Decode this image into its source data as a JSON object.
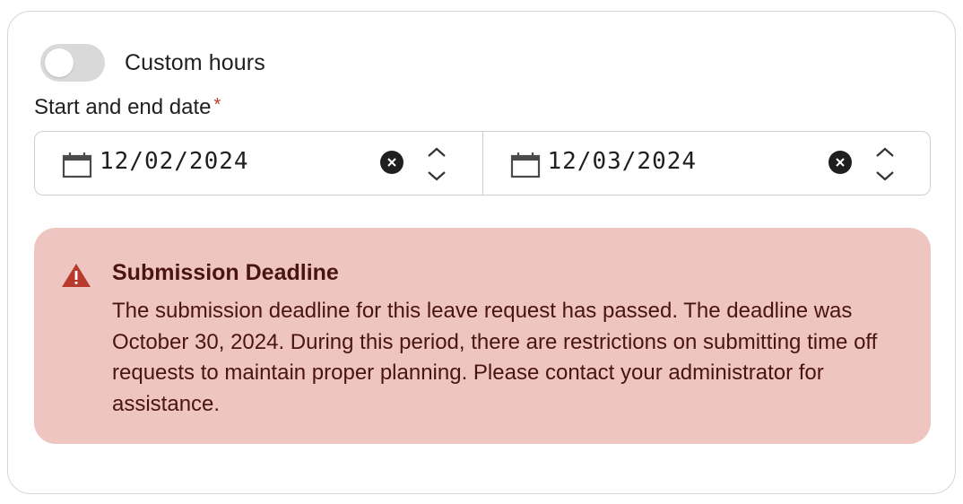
{
  "toggle": {
    "label": "Custom hours",
    "on": false
  },
  "date_field": {
    "label": "Start and end date",
    "required_mark": "*",
    "start": "12/02/2024",
    "end": "12/03/2024"
  },
  "alert": {
    "title": "Submission Deadline",
    "body": "The submission deadline for this leave request has passed. The deadline was October 30, 2024. During this period, there are restrictions on submitting time off requests to maintain proper planning. Please contact your administrator for assistance."
  },
  "colors": {
    "alert_bg": "#eec5c0",
    "alert_text": "#4a1410",
    "warning_icon": "#b83a2c",
    "required": "#c0392b"
  },
  "icons": {
    "calendar": "calendar-icon",
    "clear": "clear-icon",
    "stepper": "chevron-up-down-icon",
    "warning": "warning-icon"
  }
}
